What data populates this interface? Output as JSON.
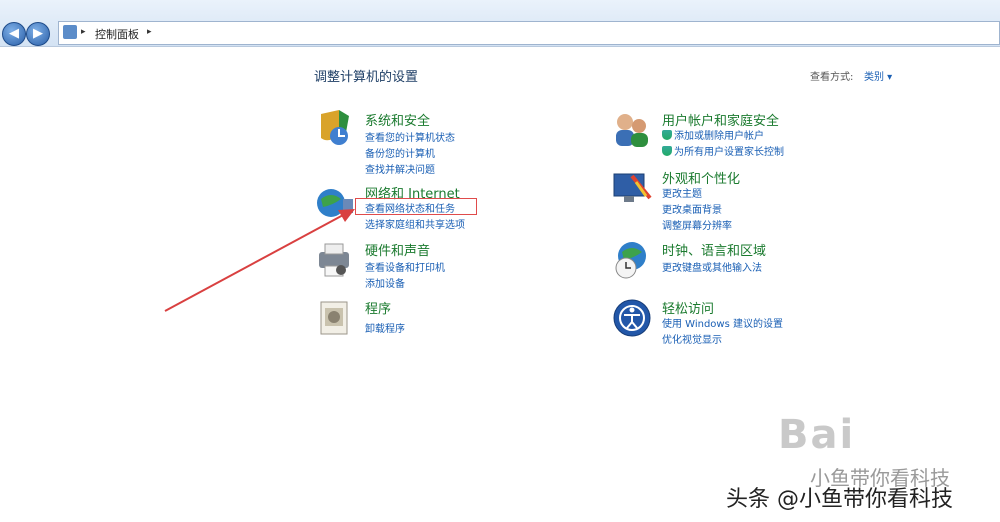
{
  "address_bar": {
    "path": "控制面板",
    "forward_chevron": "▸"
  },
  "main": {
    "heading": "调整计算机的设置",
    "view_by_label": "查看方式:",
    "view_by_value": "类别 ▾"
  },
  "categories": [
    {
      "title": "系统和安全",
      "links": [
        "查看您的计算机状态",
        "备份您的计算机",
        "查找并解决问题"
      ]
    },
    {
      "title": "网络和 Internet",
      "links": [
        "查看网络状态和任务",
        "选择家庭组和共享选项"
      ]
    },
    {
      "title": "硬件和声音",
      "links": [
        "查看设备和打印机",
        "添加设备"
      ]
    },
    {
      "title": "程序",
      "links": [
        "卸载程序"
      ]
    },
    {
      "title": "用户帐户和家庭安全",
      "links": [
        "添加或删除用户帐户",
        "为所有用户设置家长控制"
      ]
    },
    {
      "title": "外观和个性化",
      "links": [
        "更改主题",
        "更改桌面背景",
        "调整屏幕分辨率"
      ]
    },
    {
      "title": "时钟、语言和区域",
      "links": [
        "更改键盘或其他输入法"
      ]
    },
    {
      "title": "轻松访问",
      "links": [
        "使用 Windows 建议的设置",
        "优化视觉显示"
      ]
    }
  ],
  "watermark": {
    "logo_text": "Bai",
    "caption": "小鱼带你看科技"
  },
  "footer": {
    "text": "头条 @小鱼带你看科技"
  },
  "colors": {
    "category_title": "#1a7a2e",
    "link": "#1a5fb4",
    "annotation": "#e04b4b"
  }
}
